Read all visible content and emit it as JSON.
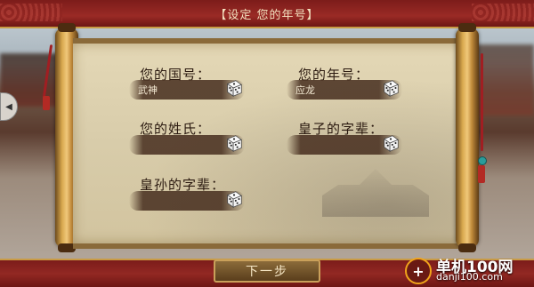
{
  "header": {
    "title": "【设定 您的年号】"
  },
  "fields": [
    {
      "label": "您的国号：",
      "value": "武神"
    },
    {
      "label": "您的年号：",
      "value": "应龙"
    },
    {
      "label": "您的姓氏：",
      "value": ""
    },
    {
      "label": "皇子的字辈：",
      "value": ""
    },
    {
      "label": "皇孙的字辈：",
      "value": ""
    }
  ],
  "icons": {
    "dice": "dice-icon",
    "side": "chevron-left-icon",
    "watermark": "danji-logo-icon"
  },
  "buttons": {
    "next_label": "下一步"
  },
  "watermark": {
    "name": "单机100网",
    "url": "danji100.com"
  },
  "colors": {
    "banner": "#8d2420",
    "paper": "#ddd0ad",
    "ink": "#46301e",
    "gold": "#c9a05a"
  }
}
